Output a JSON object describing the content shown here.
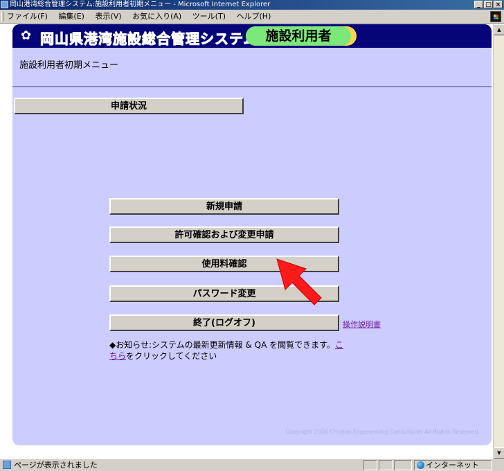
{
  "window": {
    "title": "岡山港湾総合管理システム:施設利用者初期メニュー - Microsoft Internet Explorer",
    "minimize": "_",
    "maximize": "□",
    "close": "×"
  },
  "menubar": {
    "items": [
      "ファイル(F)",
      "編集(E)",
      "表示(V)",
      "お気に入り(A)",
      "ツール(T)",
      "ヘルプ(H)"
    ]
  },
  "banner": {
    "icon": "flower-icon",
    "system_title": "岡山県港湾施設総合管理システム",
    "role_label": "施設利用者"
  },
  "page": {
    "subtitle": "施設利用者初期メニュー",
    "status_button": "申請状況",
    "menu_buttons": {
      "new_application": "新規申請",
      "permit_check": "許可確認および変更申請",
      "fee_check": "使用料確認",
      "password_change": "パスワード変更",
      "logout": "終了(ログオフ)"
    },
    "manual_link": "操作説明書",
    "notice_prefix": "◆お知らせ:システムの最新更新情報 & QA を閲覧できます。",
    "notice_link": "こちら",
    "notice_suffix": "をクリックしてください",
    "copyright": "Copyright 2006 Chuden Engeneering Consultants All Rights Reserved."
  },
  "statusbar": {
    "text": "ページが表示されました",
    "zone": "インターネット"
  },
  "colors": {
    "page_bg": "#ccccff",
    "banner_bg": "#050578",
    "role_pill": "#7de87a",
    "role_pill_edge": "#ffd24a",
    "pointer_arrow": "#ff1a1a"
  }
}
